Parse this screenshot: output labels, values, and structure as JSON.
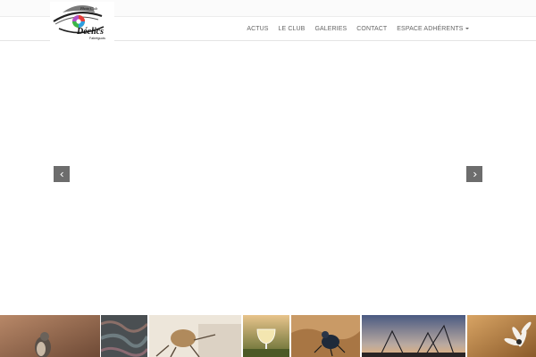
{
  "logo": {
    "alt": "Photo Club Déclics Fabréguois",
    "line1": "Photo Club",
    "line2": "Déclics",
    "line3": "Fabrèguois"
  },
  "nav": {
    "items": [
      {
        "label": "ACTUS",
        "has_dropdown": false
      },
      {
        "label": "LE CLUB",
        "has_dropdown": false
      },
      {
        "label": "GALERIES",
        "has_dropdown": false
      },
      {
        "label": "CONTACT",
        "has_dropdown": false
      },
      {
        "label": "ESPACE ADHÉRENTS",
        "has_dropdown": true
      }
    ]
  },
  "slider": {
    "prev_icon": "chevron-left-icon",
    "next_icon": "chevron-right-icon"
  },
  "gallery": {
    "thumbnails": [
      {
        "subject": "bird"
      },
      {
        "subject": "texture"
      },
      {
        "subject": "insect"
      },
      {
        "subject": "wine-glass"
      },
      {
        "subject": "beetle"
      },
      {
        "subject": "trampoline-silhouettes"
      },
      {
        "subject": "flower"
      }
    ]
  },
  "colors": {
    "nav_text": "#666666",
    "arrow_bg": "#6d6d6d",
    "topbar_bg": "#fbfbfb"
  }
}
